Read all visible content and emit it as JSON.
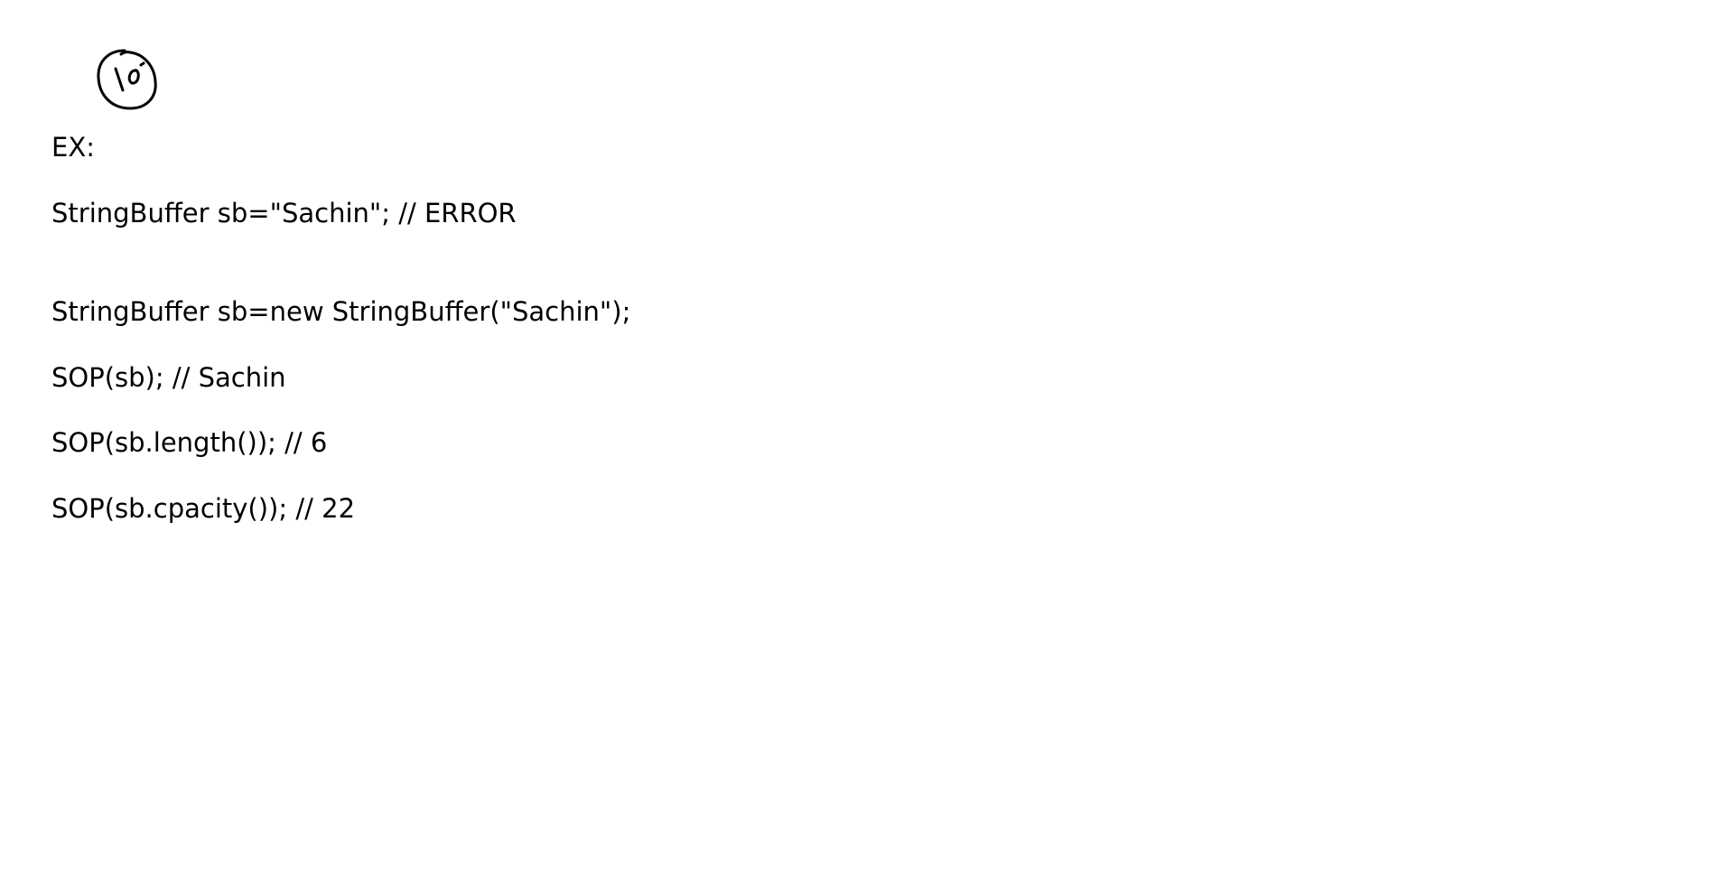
{
  "page_marker": {
    "text": "10",
    "icon": "handwritten-circled-number-icon"
  },
  "lines": [
    "EX:",
    "StringBuffer sb=\"Sachin\"; // ERROR",
    "StringBuffer sb=new StringBuffer(\"Sachin\");",
    "SOP(sb); // Sachin",
    "SOP(sb.length()); // 6",
    "SOP(sb.cpacity()); // 22"
  ]
}
